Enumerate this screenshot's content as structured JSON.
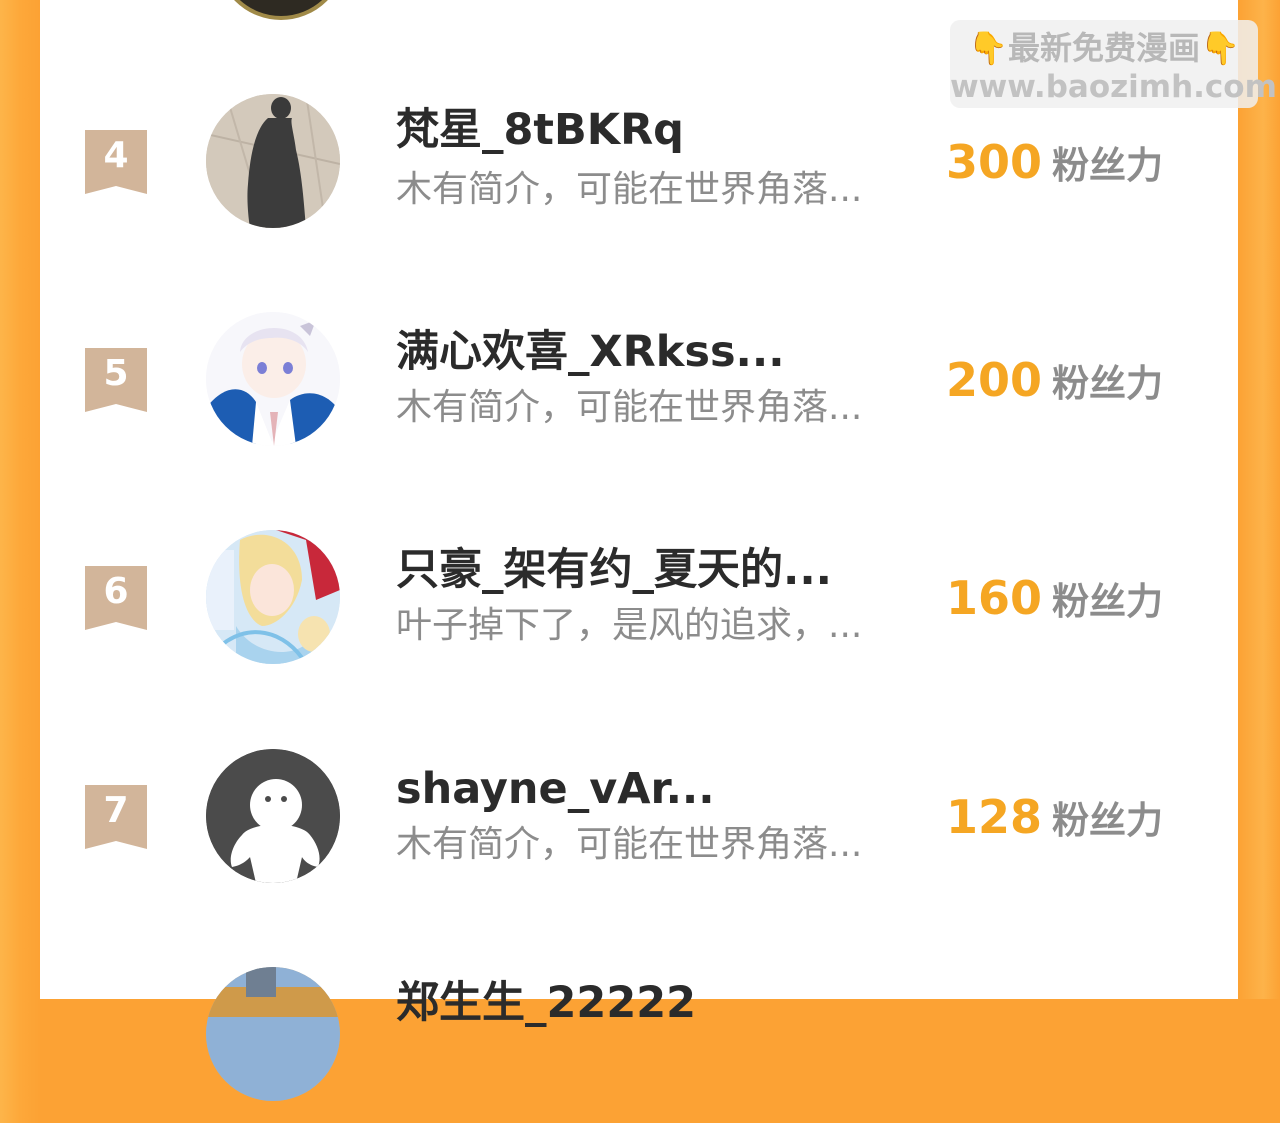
{
  "watermark": {
    "hand_left": "👇",
    "title": "最新免费漫画",
    "hand_right": "👇",
    "url": "www.baozimh.com"
  },
  "fans_unit": "粉丝力",
  "ranking": [
    {
      "rank": "4",
      "name": "梵星_8tBKRq",
      "bio": "木有简介，可能在世界角落...",
      "score": "300",
      "avatar": "shadow-photo-avatar"
    },
    {
      "rank": "5",
      "name": "满心欢喜_XRkss...",
      "bio": "木有简介，可能在世界角落...",
      "score": "200",
      "avatar": "anime-boy-avatar"
    },
    {
      "rank": "6",
      "name": "只豪_架有约_夏天的...",
      "bio": "叶子掉下了，是风的追求，...",
      "score": "160",
      "avatar": "comic-cover-avatar"
    },
    {
      "rank": "7",
      "name": "shayne_vAr...",
      "bio": "木有简介，可能在世界角落...",
      "score": "128",
      "avatar": "default-user-avatar"
    },
    {
      "rank": "",
      "name": "郑生生_22222",
      "bio": "",
      "score": "",
      "avatar": "photo-avatar"
    }
  ],
  "colors": {
    "accent": "#f5a623",
    "badge": "#d2b59a",
    "page_bg": "#fca234"
  }
}
